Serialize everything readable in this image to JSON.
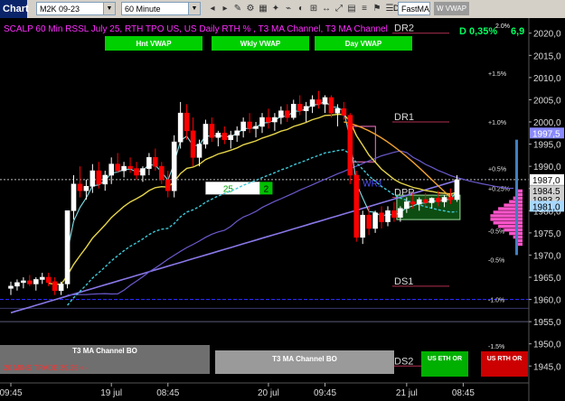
{
  "toolbar": {
    "title": "Chart",
    "symbol": "M2K 09-23",
    "interval": "60 Minute",
    "buttons": [
      "◂",
      "▸",
      "✎",
      "⚙",
      "▦",
      "✦",
      "⌁",
      "◐",
      "⊞",
      "↔",
      "⤢",
      "▤",
      "≡",
      "⚑",
      "☰"
    ],
    "study_text": "DR2",
    "fast_ma": "FastMA",
    "wvwap": "W VWAP"
  },
  "chart_data": {
    "type": "candlestick",
    "header": "SCALP 60 Min RSSL July 25, RTH TPO US, US Daily RTH % , T3 MA Channel, T3 MA Channel",
    "change_label": "D 0,35%",
    "change_label_tail": "6,9",
    "superscript": "2.0%",
    "top_buttons": [
      "Hnt VWAP",
      "Wkly VWAP",
      "Day VWAP"
    ],
    "ylim": [
      1942,
      2023
    ],
    "y_ticks": [
      1945,
      1950,
      1955,
      1960,
      1965,
      1970,
      1975,
      1980,
      1985,
      1990,
      1995,
      2000,
      2005,
      2010,
      2015,
      2020
    ],
    "y_tick_labels": [
      "1945,0",
      "1950,0",
      "1955,0",
      "1960,0",
      "1965,0",
      "1970,0",
      "1975,0",
      "1980,0",
      "1985,0",
      "1990,0",
      "1995,0",
      "2000,0",
      "2005,0",
      "2010,0",
      "2015,0",
      "2020,0"
    ],
    "x_ticks": [
      {
        "bar": 0,
        "label": "09:45"
      },
      {
        "bar": 16,
        "label": "19 jul"
      },
      {
        "bar": 25,
        "label": "08:45"
      },
      {
        "bar": 41,
        "label": "20 jul"
      },
      {
        "bar": 50,
        "label": "09:45"
      },
      {
        "bar": 63,
        "label": "21 jul"
      },
      {
        "bar": 72,
        "label": "08:45"
      }
    ],
    "candles": [
      [
        1962.5,
        1964.0,
        1961.0,
        1963.0
      ],
      [
        1963.0,
        1964.5,
        1962.0,
        1963.8
      ],
      [
        1963.8,
        1965.0,
        1962.5,
        1964.2
      ],
      [
        1964.2,
        1965.5,
        1963.0,
        1963.5
      ],
      [
        1963.5,
        1965.0,
        1962.0,
        1964.5
      ],
      [
        1964.5,
        1966.0,
        1963.5,
        1965.0
      ],
      [
        1965.0,
        1966.0,
        1963.0,
        1963.8
      ],
      [
        1964.0,
        1965.0,
        1961.0,
        1962.0
      ],
      [
        1962.0,
        1964.0,
        1961.0,
        1963.5
      ],
      [
        1963.5,
        1975.0,
        1962.5,
        1980.0
      ],
      [
        1980.0,
        1988.0,
        1978.0,
        1986.0
      ],
      [
        1986.0,
        1990.0,
        1983.0,
        1984.5
      ],
      [
        1984.5,
        1987.0,
        1982.5,
        1985.5
      ],
      [
        1985.5,
        1990.5,
        1984.0,
        1989.0
      ],
      [
        1989.0,
        1991.0,
        1985.0,
        1986.0
      ],
      [
        1986.0,
        1989.0,
        1984.5,
        1988.0
      ],
      [
        1988.0,
        1992.0,
        1986.0,
        1990.5
      ],
      [
        1990.5,
        1993.0,
        1988.5,
        1989.0
      ],
      [
        1989.0,
        1991.0,
        1987.5,
        1990.0
      ],
      [
        1990.0,
        1992.0,
        1988.5,
        1989.5
      ],
      [
        1989.5,
        1991.0,
        1987.0,
        1988.0
      ],
      [
        1988.0,
        1990.0,
        1986.5,
        1989.5
      ],
      [
        1989.5,
        1993.0,
        1988.0,
        1992.0
      ],
      [
        1992.0,
        1994.0,
        1989.0,
        1990.0
      ],
      [
        1990.0,
        1991.0,
        1986.0,
        1987.0
      ],
      [
        1987.0,
        1989.0,
        1983.0,
        1984.5
      ],
      [
        1984.5,
        1997.0,
        1983.0,
        1995.5
      ],
      [
        1995.5,
        2004.5,
        1994.0,
        2002.0
      ],
      [
        2002.0,
        2004.0,
        1996.0,
        1998.0
      ],
      [
        1998.0,
        2001.0,
        1990.0,
        1992.0
      ],
      [
        1992.0,
        1996.0,
        1990.0,
        1995.0
      ],
      [
        1995.0,
        2000.5,
        1994.0,
        1999.5
      ],
      [
        1999.5,
        2001.0,
        1995.5,
        1996.5
      ],
      [
        1996.5,
        1998.0,
        1994.5,
        1997.5
      ],
      [
        1997.5,
        1999.0,
        1995.0,
        1996.0
      ],
      [
        1996.0,
        1998.0,
        1994.0,
        1997.0
      ],
      [
        1997.0,
        1999.0,
        1995.5,
        1998.0
      ],
      [
        1998.0,
        2001.0,
        1996.5,
        2000.0
      ],
      [
        2000.0,
        2002.0,
        1997.5,
        1998.5
      ],
      [
        1998.5,
        2000.0,
        1996.5,
        1999.0
      ],
      [
        1999.0,
        2002.0,
        1997.5,
        2001.0
      ],
      [
        2001.0,
        2003.0,
        1998.5,
        2000.0
      ],
      [
        2000.0,
        2002.0,
        1998.0,
        2001.0
      ],
      [
        2001.0,
        2003.5,
        1999.5,
        2002.5
      ],
      [
        2002.5,
        2004.0,
        2000.0,
        2001.0
      ],
      [
        2001.0,
        2005.0,
        2000.5,
        2004.0
      ],
      [
        2004.0,
        2006.0,
        2001.5,
        2002.5
      ],
      [
        2002.5,
        2004.5,
        2000.0,
        2003.5
      ],
      [
        2003.5,
        2006.0,
        2002.0,
        2005.0
      ],
      [
        2005.0,
        2007.0,
        2003.0,
        2004.0
      ],
      [
        2004.0,
        2006.0,
        2002.0,
        2005.5
      ],
      [
        2005.5,
        2006.0,
        2001.0,
        2002.0
      ],
      [
        2002.0,
        2004.0,
        1999.0,
        2003.0
      ],
      [
        2003.0,
        2004.5,
        2000.5,
        2001.5
      ],
      [
        2001.5,
        2002.0,
        1986.0,
        1988.0
      ],
      [
        1988.0,
        1989.0,
        1973.0,
        1974.0
      ],
      [
        1974.0,
        1980.0,
        1972.5,
        1979.0
      ],
      [
        1979.0,
        1981.0,
        1974.5,
        1976.0
      ],
      [
        1976.0,
        1980.0,
        1975.0,
        1979.5
      ],
      [
        1979.5,
        1981.0,
        1976.0,
        1977.5
      ],
      [
        1977.5,
        1981.0,
        1976.5,
        1980.0
      ],
      [
        1980.0,
        1982.0,
        1977.5,
        1978.5
      ],
      [
        1978.5,
        1981.0,
        1977.5,
        1980.5
      ],
      [
        1980.5,
        1983.0,
        1979.5,
        1982.0
      ],
      [
        1982.0,
        1984.0,
        1980.5,
        1981.5
      ],
      [
        1981.5,
        1983.0,
        1980.0,
        1982.5
      ],
      [
        1982.5,
        1984.0,
        1981.0,
        1981.8
      ],
      [
        1981.8,
        1983.0,
        1980.5,
        1982.8
      ],
      [
        1982.8,
        1984.5,
        1981.0,
        1982.0
      ],
      [
        1982.0,
        1983.5,
        1980.8,
        1983.0
      ],
      [
        1983.0,
        1985.0,
        1981.5,
        1982.5
      ],
      [
        1982.5,
        1988.0,
        1982.0,
        1987.0
      ]
    ],
    "hlines": [
      {
        "y": 1960.0,
        "color": "#2a2aff",
        "dash": "4,2"
      },
      {
        "y": 1958.0,
        "color": "#3a3a6a",
        "dash": ""
      },
      {
        "y": 1955.0,
        "color": "#5a5a7a",
        "dash": ""
      },
      {
        "y": 1987.0,
        "color": "#bbbbbb",
        "dash": "2,2"
      }
    ],
    "levels": [
      {
        "y": 2020.0,
        "label": "DR2"
      },
      {
        "y": 2000.0,
        "label": "DR1"
      },
      {
        "y": 1983.0,
        "label": "DPP"
      },
      {
        "y": 1963.0,
        "label": "DS1"
      },
      {
        "y": 1945.0,
        "label": "DS2"
      }
    ],
    "pct_labels": [
      {
        "y": 2011.0,
        "label": "+1.5%"
      },
      {
        "y": 2000.0,
        "label": "+1.0%"
      },
      {
        "y": 1989.5,
        "label": "+0.5%"
      },
      {
        "y": 1985.0,
        "label": "+0.25%"
      },
      {
        "y": 1975.5,
        "label": "-0.5%"
      },
      {
        "y": 1969.0,
        "label": "-0.5%"
      },
      {
        "y": 1960.0,
        "label": "-1.0%"
      },
      {
        "y": 1949.5,
        "label": "-1.5%"
      }
    ],
    "price_tags": [
      {
        "y": 1997.5,
        "label": "1997,5",
        "bg": "#8a8aff",
        "fg": "#ffffff"
      },
      {
        "y": 1987.0,
        "label": "1987,0",
        "bg": "#ffffff",
        "fg": "#000000"
      },
      {
        "y": 1984.5,
        "label": "1984,5",
        "bg": "#cfcfcf",
        "fg": "#000000"
      },
      {
        "y": 1982.5,
        "label": "1983,2",
        "bg": "#cfcfcf",
        "fg": "#000000"
      },
      {
        "y": 1981.0,
        "label": "1981,0",
        "bg": "#a8d8ff",
        "fg": "#000000"
      }
    ],
    "wr_label": "WR1",
    "countdown_left": "25",
    "countdown_right": "2",
    "bottom_labels": [
      {
        "text": "T3 MA Channel BO",
        "dark": true
      },
      {
        "text": "T3 MA Channel BO",
        "dark": false
      }
    ],
    "bottom_red_text": "20 MINS TRADE 39.25 <-",
    "rth_buttons": [
      {
        "text": "US ETH OR",
        "bg": "#00b000"
      },
      {
        "text": "US RTH OR",
        "bg": "#cc0000"
      }
    ],
    "colors": {
      "up_candle": "#ffffff",
      "down_candle": "#ff0000",
      "yellow_ma": "#e5d44a",
      "orange_ma": "#f0a030",
      "cyan_band": "#40c8d8",
      "purple_line": "#8878e8",
      "profile": "#ff55cc",
      "header": "#ff2cff",
      "buttons": "#00d000"
    }
  }
}
